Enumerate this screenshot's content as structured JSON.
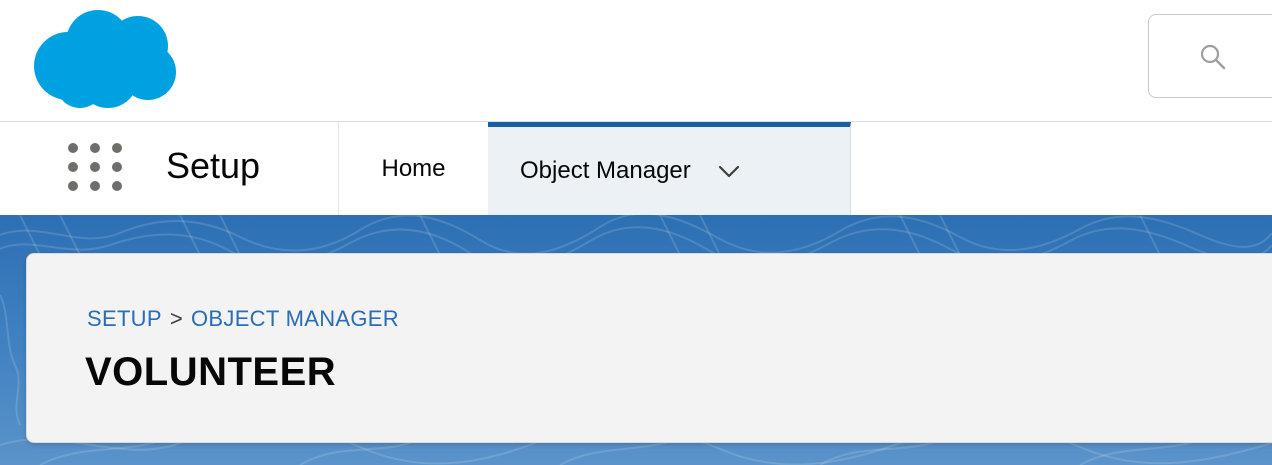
{
  "header": {
    "logo_icon": "salesforce-cloud-icon",
    "logo_color": "#00a1e0",
    "search_icon": "search-icon"
  },
  "nav": {
    "app_launcher_icon": "app-launcher-grid-icon",
    "app_name": "Setup",
    "items": [
      {
        "label": "Home",
        "active": false
      },
      {
        "label": "Object Manager",
        "active": true,
        "has_dropdown": true
      }
    ],
    "active_accent": "#1b5f9e"
  },
  "page": {
    "breadcrumb": [
      "SETUP",
      "OBJECT MANAGER"
    ],
    "breadcrumb_separator": ">",
    "title": "VOLUNTEER",
    "banner_color": "#2d6fb3"
  }
}
